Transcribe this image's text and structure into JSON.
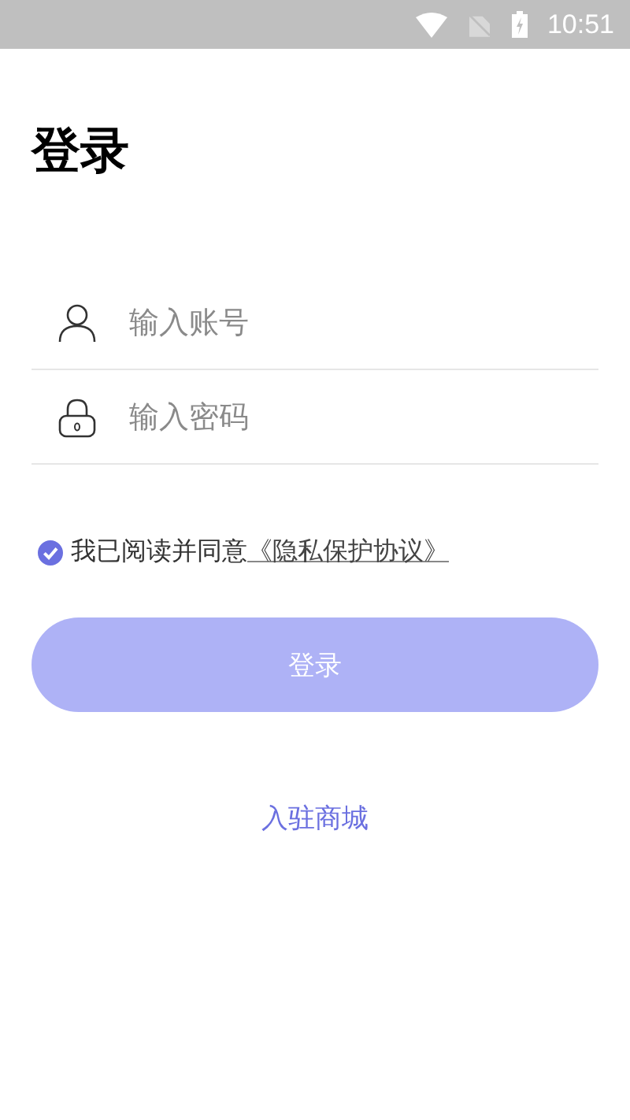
{
  "status_bar": {
    "time": "10:51"
  },
  "title": "登录",
  "fields": [
    {
      "kind": "account",
      "placeholder": "输入账号"
    },
    {
      "kind": "password",
      "placeholder": "输入密码"
    }
  ],
  "agreement": {
    "checked": true,
    "text": "我已阅读并同意",
    "link": "《隐私保护协议》"
  },
  "login_button": "登录",
  "register_link": "入驻商城"
}
